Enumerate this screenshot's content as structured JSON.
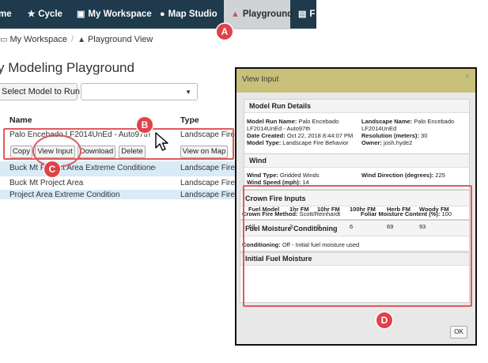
{
  "nav": {
    "items": [
      {
        "label": "me",
        "icon": ""
      },
      {
        "label": "Cycle",
        "icon": "cycle-icon"
      },
      {
        "label": "My Workspace",
        "icon": "workspace-icon"
      },
      {
        "label": "Map Studio",
        "icon": "globe-icon"
      },
      {
        "label": "Playground",
        "icon": "flame-icon",
        "active": true
      },
      {
        "label": "F",
        "icon": "clipboard-icon"
      }
    ]
  },
  "breadcrumb": {
    "item1": "My Workspace",
    "separator": "/",
    "item2": "Playground View"
  },
  "page": {
    "title": "y Modeling Playground"
  },
  "model_select": {
    "button_label": "Select Model to Run",
    "selected_value": ""
  },
  "table": {
    "headers": {
      "name": "Name",
      "type": "Type"
    },
    "rows": [
      {
        "name": "Palo Encebado LF2014UnEd - Auto97th",
        "type": "Landscape Fire Be"
      },
      {
        "name": "Buck Mt Project Area Extreme Conditioned",
        "type": "Landscape Fire Be"
      },
      {
        "name": "Buck Mt Project Area",
        "type": "Landscape Fire Be"
      },
      {
        "name": "Project Area Extreme Condition",
        "type": "Landscape Fire B"
      }
    ],
    "row_actions": {
      "copy": "Copy",
      "view_input": "View Input",
      "download": "Download",
      "delete": "Delete",
      "view_on_map": "View on Map"
    }
  },
  "annotations": {
    "a": "A",
    "b": "B",
    "c": "C",
    "d": "D",
    "color": "#e0595e"
  },
  "modal": {
    "title": "View Input",
    "close": "×",
    "model_run_details": {
      "heading": "Model Run Details",
      "model_run_name_label": "Model Run Name:",
      "model_run_name": "Palo Encebado",
      "model_run_name_line2": "LF2014UnEd - Auto97th",
      "date_created_label": "Date Created:",
      "date_created": "Oct 22, 2018 8:44:07 PM",
      "model_type_label": "Model Type:",
      "model_type": "Landscape Fire Behavior",
      "landscape_name_label": "Landscape Name:",
      "landscape_name": "Palo Encebado",
      "landscape_name_line2": "LF2014UnEd",
      "resolution_label": "Resolution (meters):",
      "resolution": "30",
      "owner_label": "Owner:",
      "owner": "josh.hyde2"
    },
    "wind": {
      "heading": "Wind",
      "wind_type_label": "Wind Type:",
      "wind_type": "Gridded Winds",
      "wind_speed_label": "Wind Speed (mph):",
      "wind_speed": "14",
      "wind_direction_label": "Wind Direction (degrees):",
      "wind_direction": "225"
    },
    "crown_fire": {
      "heading": "Crown Fire Inputs",
      "method_label": "Crown Fire Method:",
      "method": "Scott/Reinhardt",
      "foliar_label": "Foliar Moisture Content (%):",
      "foliar": "100"
    },
    "fuel_conditioning": {
      "heading": "Fuel Moisture Conditioning",
      "label": "Conditioning:",
      "value": "Off - Initial fuel moisture used"
    },
    "initial_fuel_moisture": {
      "heading": "Initial Fuel Moisture",
      "columns": [
        "Fuel Model",
        "1hr FM",
        "10hr FM",
        "100hr FM",
        "Herb FM",
        "Woody FM"
      ],
      "row": [
        "All",
        "3",
        "3",
        "6",
        "69",
        "93"
      ]
    },
    "ok_label": "OK"
  }
}
